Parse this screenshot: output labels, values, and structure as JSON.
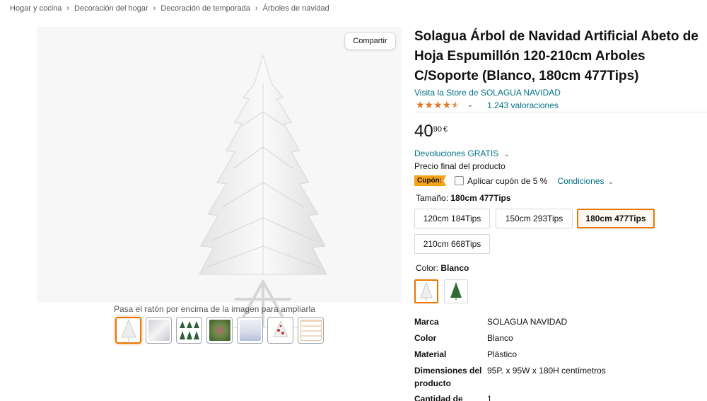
{
  "breadcrumb": [
    "Hogar y cocina",
    "Decoración del hogar",
    "Decoración de temporada",
    "Árboles de navidad"
  ],
  "breadcrumb_sep": "›",
  "gallery": {
    "share_label": "Compartir",
    "zoom_hint": "Pasa el ratón por encima de la imagen para ampliarla",
    "thumbnail_count": 7
  },
  "product": {
    "title": "Solagua Árbol de Navidad Artificial Abeto de Hoja Espumillón 120-210cm Arboles C/Soporte (Blanco, 180cm 477Tips)",
    "store_link": "Visita la Store de SOLAGUA NAVIDAD",
    "rating_stars": 4.5,
    "rating_count": "1.243 valoraciones"
  },
  "price": {
    "whole": "40",
    "fraction": "90",
    "currency": "€"
  },
  "returns_label": "Devoluciones GRATIS",
  "final_price_label": "Precio final del producto",
  "coupon": {
    "badge": "Cupón:",
    "apply_text": "Aplicar cupón de 5 %",
    "conditions": "Condiciones"
  },
  "size": {
    "label": "Tamaño:",
    "selected": "180cm 477Tips",
    "options": [
      "120cm 184Tips",
      "150cm 293Tips",
      "180cm 477Tips",
      "210cm 668Tips"
    ]
  },
  "color": {
    "label": "Color:",
    "selected": "Blanco",
    "swatches": [
      "white-tree",
      "green-tree"
    ]
  },
  "specs": [
    {
      "key": "Marca",
      "value": "SOLAGUA NAVIDAD"
    },
    {
      "key": "Color",
      "value": "Blanco"
    },
    {
      "key": "Material",
      "value": "Plástico"
    },
    {
      "key": "Dimensiones del producto",
      "value": "95P. x 95W x 180H centímetros"
    },
    {
      "key": "Cantidad de",
      "value": "1"
    }
  ],
  "colors": {
    "link": "#007185",
    "star": "#de7921",
    "selected_border": "#e77600",
    "coupon_badge": "#f7a21b"
  }
}
